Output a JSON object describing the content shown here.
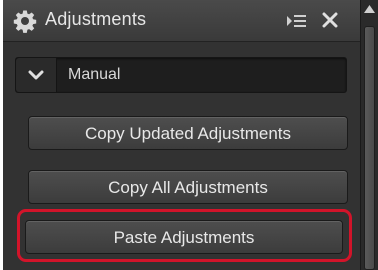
{
  "panel": {
    "title": "Adjustments",
    "icons": {
      "header": "gear-icon",
      "panel_menu": "list-expand-icon",
      "close": "close-icon"
    }
  },
  "dropdown": {
    "selected": "Manual",
    "icon": "chevron-down-icon"
  },
  "buttons": {
    "copy_updated": "Copy Updated Adjustments",
    "copy_all": "Copy All Adjustments",
    "paste": "Paste Adjustments"
  },
  "highlight": {
    "target": "paste",
    "color": "#d2142a"
  },
  "colors": {
    "panel_bg": "#323232",
    "button_text": "#e8e8e8"
  }
}
